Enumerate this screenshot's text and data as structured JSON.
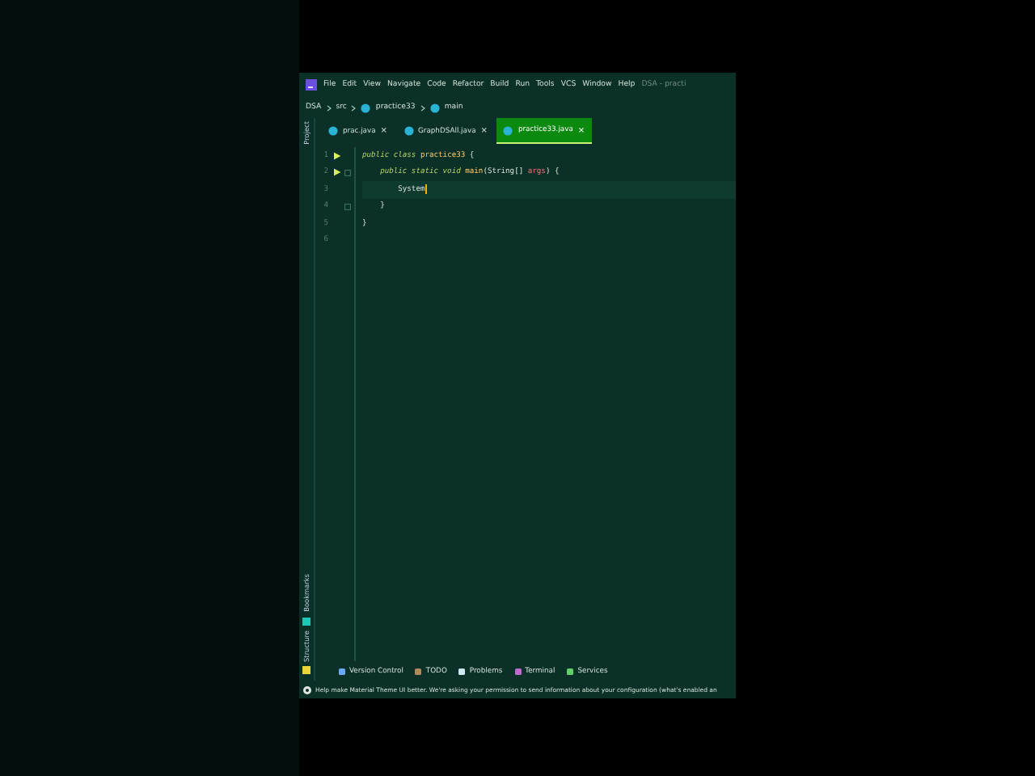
{
  "menu": {
    "items": [
      "File",
      "Edit",
      "View",
      "Navigate",
      "Code",
      "Refactor",
      "Build",
      "Run",
      "Tools",
      "VCS",
      "Window",
      "Help"
    ],
    "title": "DSA - practi"
  },
  "breadcrumb": [
    "DSA",
    "src",
    "practice33",
    "main"
  ],
  "tool_strip": {
    "top": "Project",
    "bottom": [
      {
        "label": "Bookmarks",
        "color": "#1fc7b6"
      },
      {
        "label": "Structure",
        "color": "#e8d33a"
      }
    ]
  },
  "tabs": [
    {
      "label": "prac.java",
      "close": "×",
      "selected": false
    },
    {
      "label": "GraphDSAll.java",
      "close": "×",
      "selected": false
    },
    {
      "label": "practice33.java",
      "close": "×",
      "selected": true
    }
  ],
  "editor": {
    "lines": [
      {
        "number": "1",
        "run": true,
        "fold": false,
        "current": false,
        "tokens": [
          {
            "kind": "keyword",
            "text": "public class "
          },
          {
            "kind": "name",
            "text": "practice33"
          },
          {
            "kind": "plain",
            "text": " {"
          }
        ]
      },
      {
        "number": "2",
        "run": true,
        "fold": true,
        "current": false,
        "tokens": [
          {
            "kind": "keyword",
            "text": "    public static void "
          },
          {
            "kind": "name",
            "text": "main"
          },
          {
            "kind": "plain",
            "text": "(String[] "
          },
          {
            "kind": "param",
            "text": "args"
          },
          {
            "kind": "plain",
            "text": ") {"
          }
        ]
      },
      {
        "number": "3",
        "run": false,
        "fold": false,
        "current": true,
        "tokens": [
          {
            "kind": "plain",
            "text": "        System"
          }
        ]
      },
      {
        "number": "4",
        "run": false,
        "fold": true,
        "current": false,
        "tokens": [
          {
            "kind": "plain",
            "text": "    }"
          }
        ]
      },
      {
        "number": "5",
        "run": false,
        "fold": false,
        "current": false,
        "tokens": [
          {
            "kind": "plain",
            "text": "}"
          }
        ]
      },
      {
        "number": "6",
        "run": false,
        "fold": false,
        "current": false
      }
    ]
  },
  "bottom_tools": [
    {
      "label": "Version Control",
      "kind": "vcs"
    },
    {
      "label": "TODO",
      "kind": "todo"
    },
    {
      "label": "Problems",
      "kind": "problems"
    },
    {
      "label": "Terminal",
      "kind": "terminal"
    },
    {
      "label": "Services",
      "kind": "services"
    }
  ],
  "notification": "Help make Material Theme UI better. We're asking your permission to send information about your configuration (what's enabled an"
}
